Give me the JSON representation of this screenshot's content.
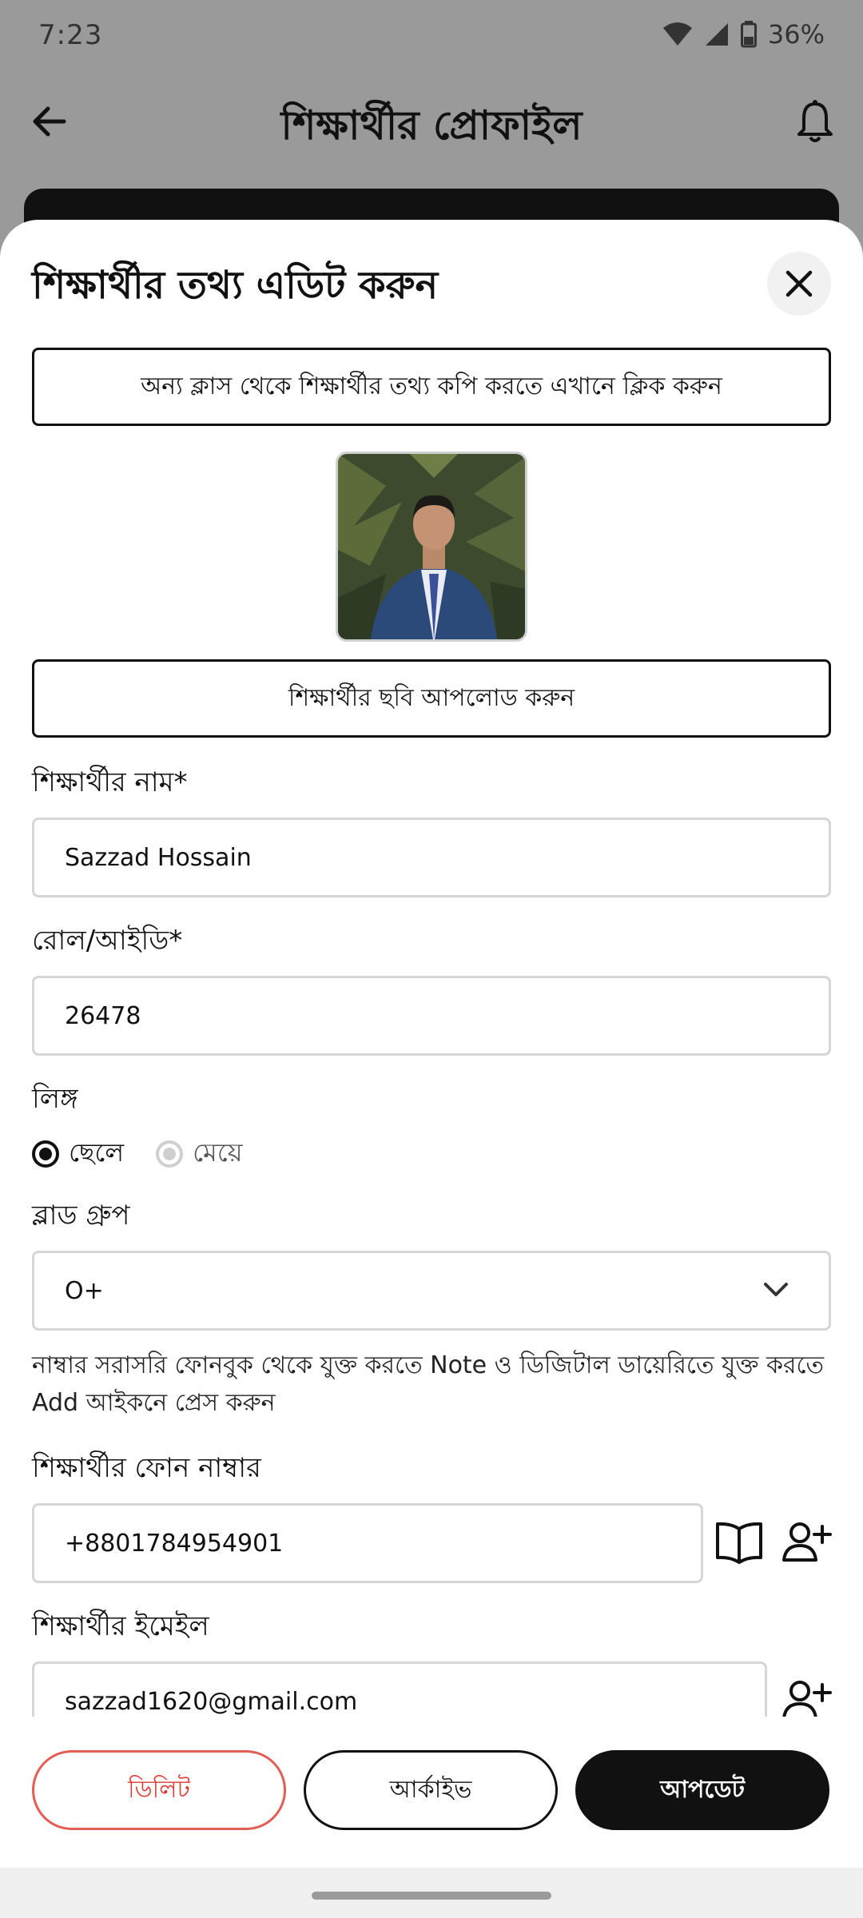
{
  "status_bar": {
    "time": "7:23",
    "battery": "36%"
  },
  "background": {
    "title": "শিক্ষার্থীর প্রোফাইল"
  },
  "sheet": {
    "title": "শিক্ষার্থীর তথ্য এডিট করুন",
    "copy_button": "অন্য ক্লাস থেকে শিক্ষার্থীর তথ্য কপি করতে এখানে ক্লিক করুন",
    "upload_button": "শিক্ষার্থীর ছবি আপলোড করুন",
    "name_label": "শিক্ষার্থীর নাম*",
    "name_value": "Sazzad Hossain",
    "roll_label": "রোল/আইডি*",
    "roll_value": "26478",
    "gender_label": "লিঙ্গ",
    "gender_options": [
      "ছেলে",
      "মেয়ে"
    ],
    "gender_selected": "ছেলে",
    "blood_label": "ব্লাড গ্রুপ",
    "blood_value": "O+",
    "hint": "নাম্বার সরাসরি ফোনবুক থেকে যুক্ত করতে Note ও ডিজিটাল ডায়েরিতে যুক্ত করতে Add আইকনে প্রেস করুন",
    "phone_label": "শিক্ষার্থীর ফোন নাম্বার",
    "phone_value": "+8801784954901",
    "email_label": "শিক্ষার্থীর ইমেইল",
    "email_value": "sazzad1620@gmail.com"
  },
  "actions": {
    "delete": "ডিলিট",
    "archive": "আর্কাইভ",
    "update": "আপডেট"
  },
  "colors": {
    "accent": "#111111",
    "danger": "#e03b33"
  }
}
